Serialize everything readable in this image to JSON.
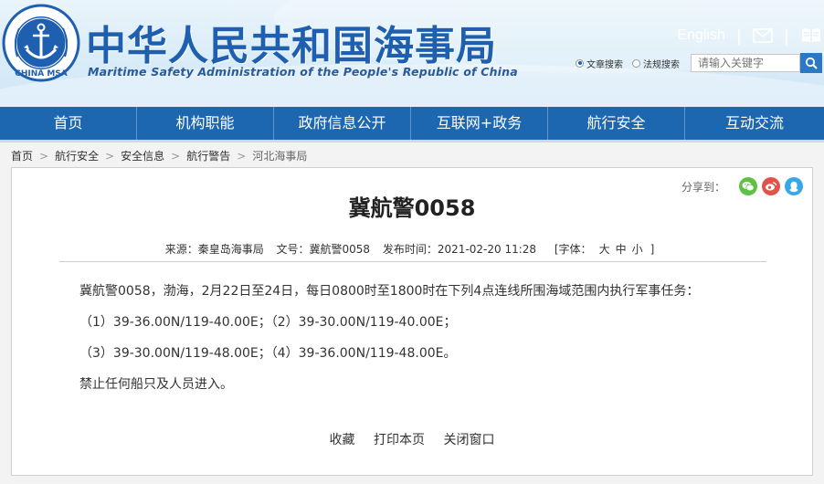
{
  "header": {
    "title_cn": "中华人民共和国海事局",
    "title_en": "Maritime Safety Administration of the People's Republic of China",
    "logo_text": "CHINA MSA",
    "english_link": "English",
    "search": {
      "option_articles": "文章搜索",
      "option_regulations": "法规搜索",
      "placeholder": "请输入关键字"
    }
  },
  "nav": {
    "items": [
      "首页",
      "机构职能",
      "政府信息公开",
      "互联网+政务",
      "航行安全",
      "互动交流"
    ]
  },
  "breadcrumb": {
    "items": [
      "首页",
      "航行安全",
      "安全信息",
      "航行警告"
    ],
    "current": "河北海事局"
  },
  "article": {
    "share_label": "分享到：",
    "title": "冀航警0058",
    "meta": {
      "source": "来源：秦皇岛海事局",
      "doc_no": "文号：冀航警0058",
      "date": "发布时间：2021-02-20 11:28",
      "font_label": "[字体：",
      "font_large": "大",
      "font_medium": "中",
      "font_small": "小",
      "font_close": "]"
    },
    "paragraphs": [
      "冀航警0058，渤海，2月22日至24日，每日0800时至1800时在下列4点连线所围海域范围内执行军事任务：",
      "（1）39-36.00N/119-40.00E；（2）39-30.00N/119-40.00E；",
      "（3）39-30.00N/119-48.00E；（4）39-36.00N/119-48.00E。",
      "禁止任何船只及人员进入。"
    ],
    "actions": {
      "favorite": "收藏",
      "print": "打印本页",
      "close": "关闭窗口"
    }
  },
  "colors": {
    "nav_blue": "#1c67b0",
    "title_blue": "#1f5fb0",
    "wechat_green": "#5ec045",
    "weibo_red": "#e0534a",
    "qq_blue": "#39a6e8"
  }
}
